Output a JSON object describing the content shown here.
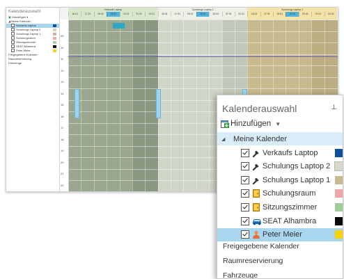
{
  "mini_sidebar": {
    "title": "Kalenderauswahl",
    "add_label": "Hinzufügen",
    "group_label": "Meine Kalender",
    "items": [
      {
        "label": "Verkaufs Laptop",
        "color": "#0e4f9e",
        "selected": true
      },
      {
        "label": "Schulungs Laptop 2",
        "color": "#cfd5c7",
        "selected": false
      },
      {
        "label": "Schulungs Laptop 1",
        "color": "#c4b894",
        "selected": false
      },
      {
        "label": "Schulungsraum",
        "color": "#f2a9ad",
        "selected": false
      },
      {
        "label": "Sitzungszimmer",
        "color": "#a6cf9f",
        "selected": false
      },
      {
        "label": "SEAT Alhambra",
        "color": "#111111",
        "selected": false
      },
      {
        "label": "Peter Meier",
        "color": "#f5d400",
        "selected": false
      }
    ],
    "other": [
      "Freigegebene Kalender",
      "Raumreservierung",
      "Fahrzeuge"
    ]
  },
  "mini_calendar": {
    "groups": [
      {
        "title": "Verkaufs Laptop",
        "color": "#9aa78e",
        "header_color": "#d9e8cc",
        "dates": [
          "16.01",
          "17.01",
          "18.01",
          "19.01",
          "20.01",
          "21.01",
          "22.01"
        ]
      },
      {
        "title": "Schulungs Laptop 2",
        "color": "#cfd5c7",
        "header_color": "#eef0e8",
        "dates": [
          "16.01",
          "17.01",
          "18.01",
          "19.01",
          "20.01",
          "21.01",
          "22.01"
        ]
      },
      {
        "title": "Schulungs Laptop 1",
        "color": "#c9b98f",
        "header_color": "#f3e3a7",
        "dates": [
          "16.01",
          "17.01",
          "18.01",
          "19.01",
          "20.01",
          "21.01",
          "22.01"
        ]
      }
    ],
    "times": [
      "09",
      "10",
      "11",
      "12",
      "13",
      "14",
      "15",
      "16",
      "17",
      "18",
      "19",
      "20",
      "21",
      "22",
      "23"
    ]
  },
  "panel": {
    "title": "Kalenderauswahl",
    "add_label": "Hinzufügen",
    "group_label": "Meine Kalender",
    "items": [
      {
        "label": "Verkaufs Laptop",
        "icon": "laptop-tool-icon",
        "color": "#0e4f9e",
        "checked": true,
        "selected": false
      },
      {
        "label": "Schulungs Laptop 2",
        "icon": "laptop-tool-icon",
        "color": "#d5dacd",
        "checked": true,
        "selected": false
      },
      {
        "label": "Schulungs Laptop 1",
        "icon": "laptop-tool-icon",
        "color": "#c8bb91",
        "checked": true,
        "selected": false
      },
      {
        "label": "Schulungsraum",
        "icon": "room-door-icon",
        "color": "#f2a5a9",
        "checked": true,
        "selected": false
      },
      {
        "label": "Sitzungszimmer",
        "icon": "room-door-icon",
        "color": "#9fcc98",
        "checked": true,
        "selected": false
      },
      {
        "label": "SEAT Alhambra",
        "icon": "car-icon",
        "color": "#0a0a0a",
        "checked": true,
        "selected": false
      },
      {
        "label": "Peter Meier",
        "icon": "person-icon",
        "color": "#f5d400",
        "checked": true,
        "selected": true
      }
    ],
    "other": [
      "Freigegebene Kalender",
      "Raumreservierung",
      "Fahrzeuge"
    ]
  }
}
